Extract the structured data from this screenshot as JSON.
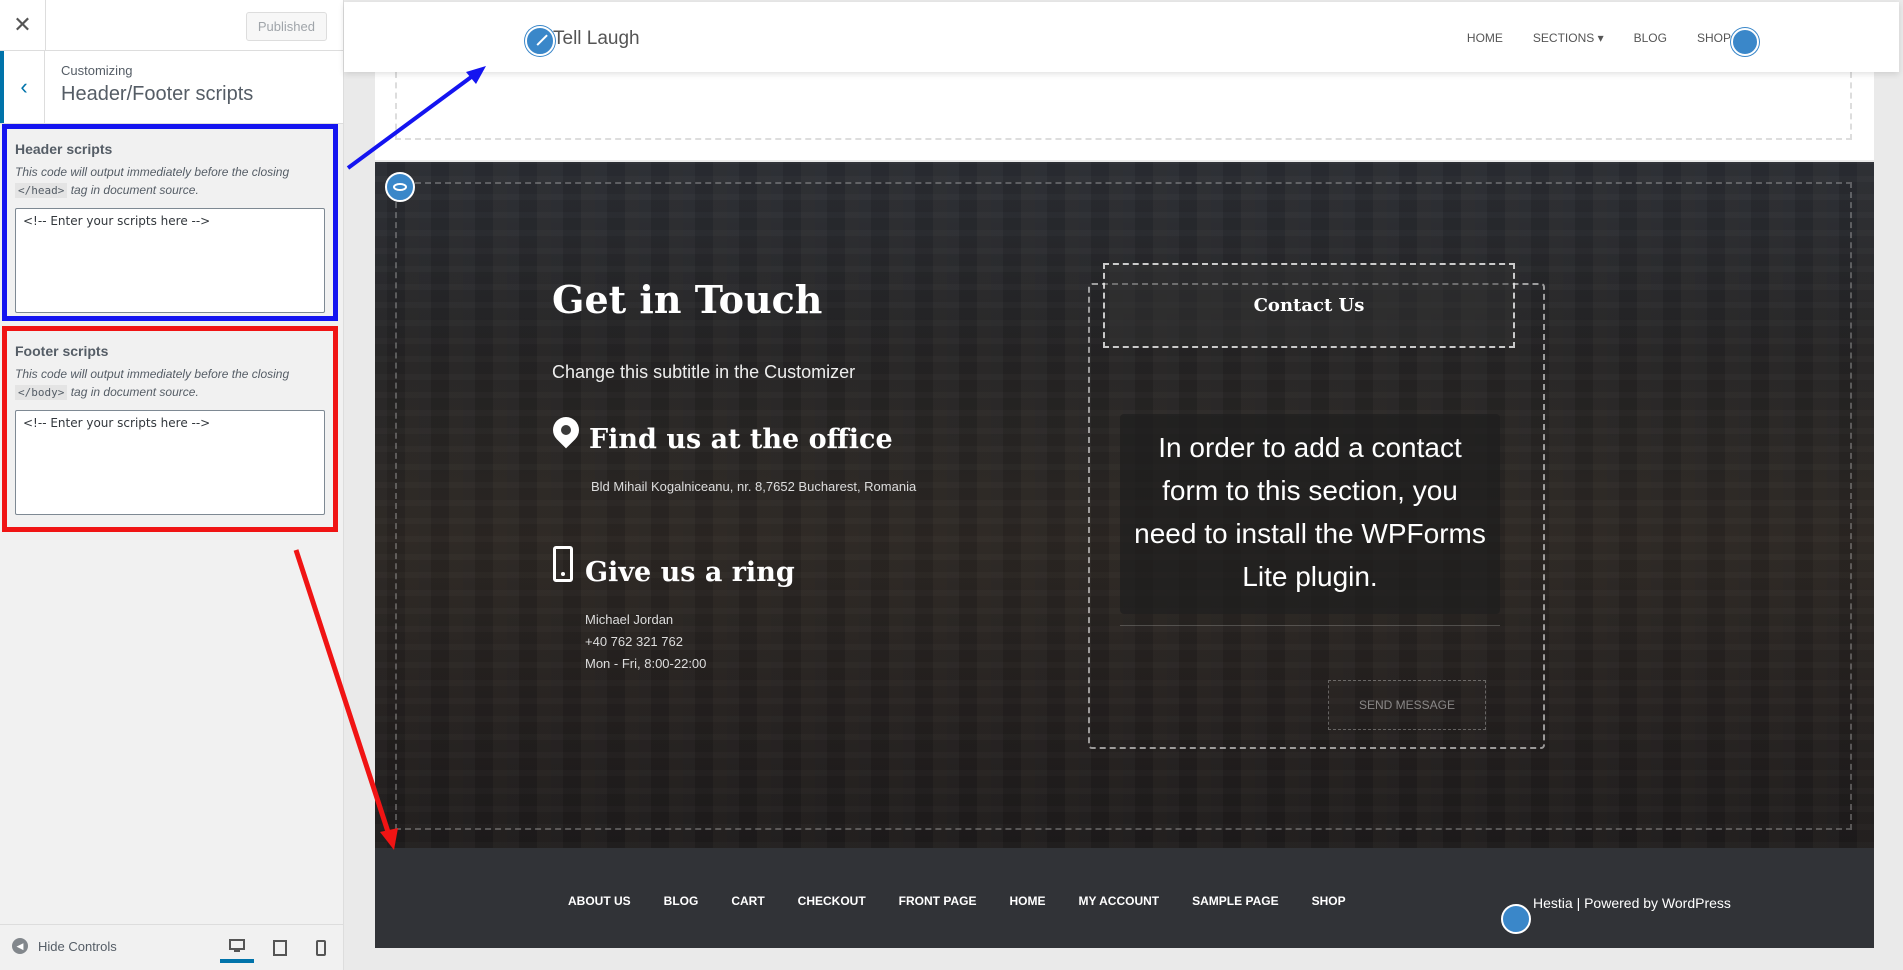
{
  "customizer": {
    "close_icon": "close-icon",
    "publish_label": "Published",
    "customizing_label": "Customizing",
    "section_title": "Header/Footer scripts",
    "header_scripts": {
      "title": "Header scripts",
      "desc_before": "This code will output immediately before the closing",
      "tag": "</head>",
      "desc_after": "tag in document source.",
      "value": "<!-- Enter your scripts here -->"
    },
    "footer_scripts": {
      "title": "Footer scripts",
      "desc_before": "This code will output immediately before the closing",
      "tag": "</body>",
      "desc_after": "tag in document source.",
      "value": "<!-- Enter your scripts here -->"
    },
    "hide_controls_label": "Hide Controls"
  },
  "site": {
    "title": "Tell Laugh",
    "nav": [
      "HOME",
      "SECTIONS",
      "BLOG",
      "SHOP"
    ],
    "contact": {
      "title": "Get in Touch",
      "subtitle": "Change this subtitle in the Customizer",
      "office_title": "Find us at the office",
      "office_address": "Bld Mihail Kogalniceanu, nr. 8,7652 Bucharest, Romania",
      "ring_title": "Give us a ring",
      "ring_name": "Michael Jordan",
      "ring_phone": "+40 762 321 762",
      "ring_hours": "Mon - Fri, 8:00-22:00",
      "form_title": "Contact Us",
      "form_message": "In order to add a contact form to this section, you need to install the WPForms Lite plugin.",
      "send_label": "SEND MESSAGE"
    },
    "footer": {
      "menu": [
        "ABOUT US",
        "BLOG",
        "CART",
        "CHECKOUT",
        "FRONT PAGE",
        "HOME",
        "MY ACCOUNT",
        "SAMPLE PAGE",
        "SHOP"
      ],
      "credit_prefix": "Hestia | Powered by ",
      "credit_link": "WordPress"
    }
  },
  "annotations": {
    "header_box_color": "#1414f0",
    "footer_box_color": "#f01414"
  }
}
